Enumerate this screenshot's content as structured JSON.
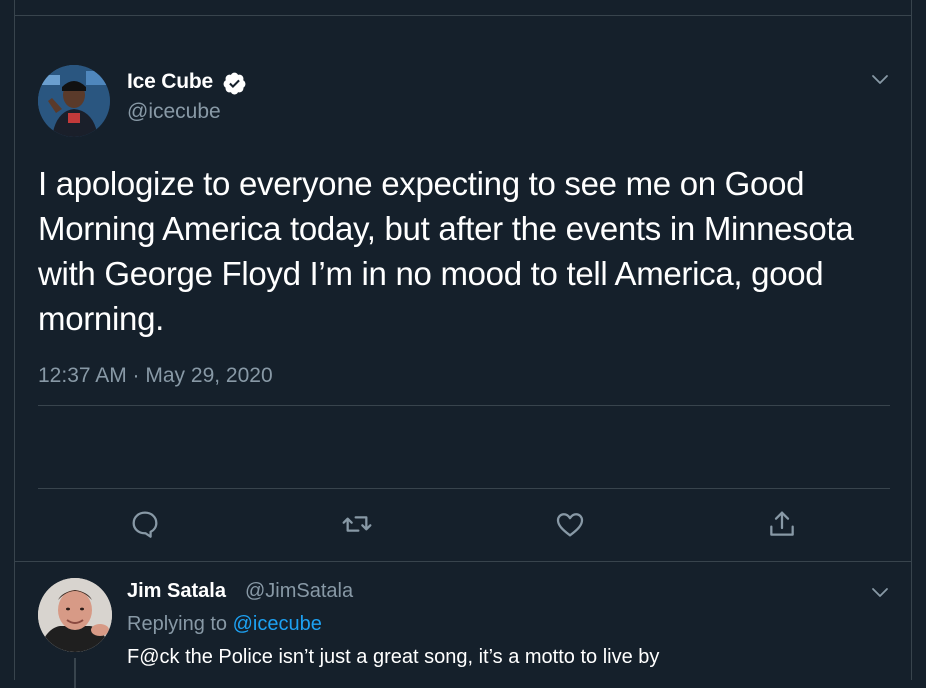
{
  "tweet": {
    "author_name": "Ice Cube",
    "author_handle": "@icecube",
    "text": "I apologize to everyone expecting to see me on Good Morning America today, but after the events in Minnesota with George Floyd I’m in no mood to tell America, good morning.",
    "timestamp": "12:37 AM · May 29, 2020",
    "verified": true,
    "actions": [
      "reply-icon",
      "retweet-icon",
      "like-icon",
      "share-icon"
    ]
  },
  "reply": {
    "author_name": "Jim Satala",
    "author_handle": "@JimSatala",
    "replying_prefix": "Replying to",
    "replying_handle": "@icecube",
    "text": "F@ck the Police isn’t just a great song, it’s a motto to live by"
  },
  "colors": {
    "background": "#15202b",
    "border": "#38444d",
    "secondary_text": "#8899a6",
    "accent": "#1da1f2"
  }
}
